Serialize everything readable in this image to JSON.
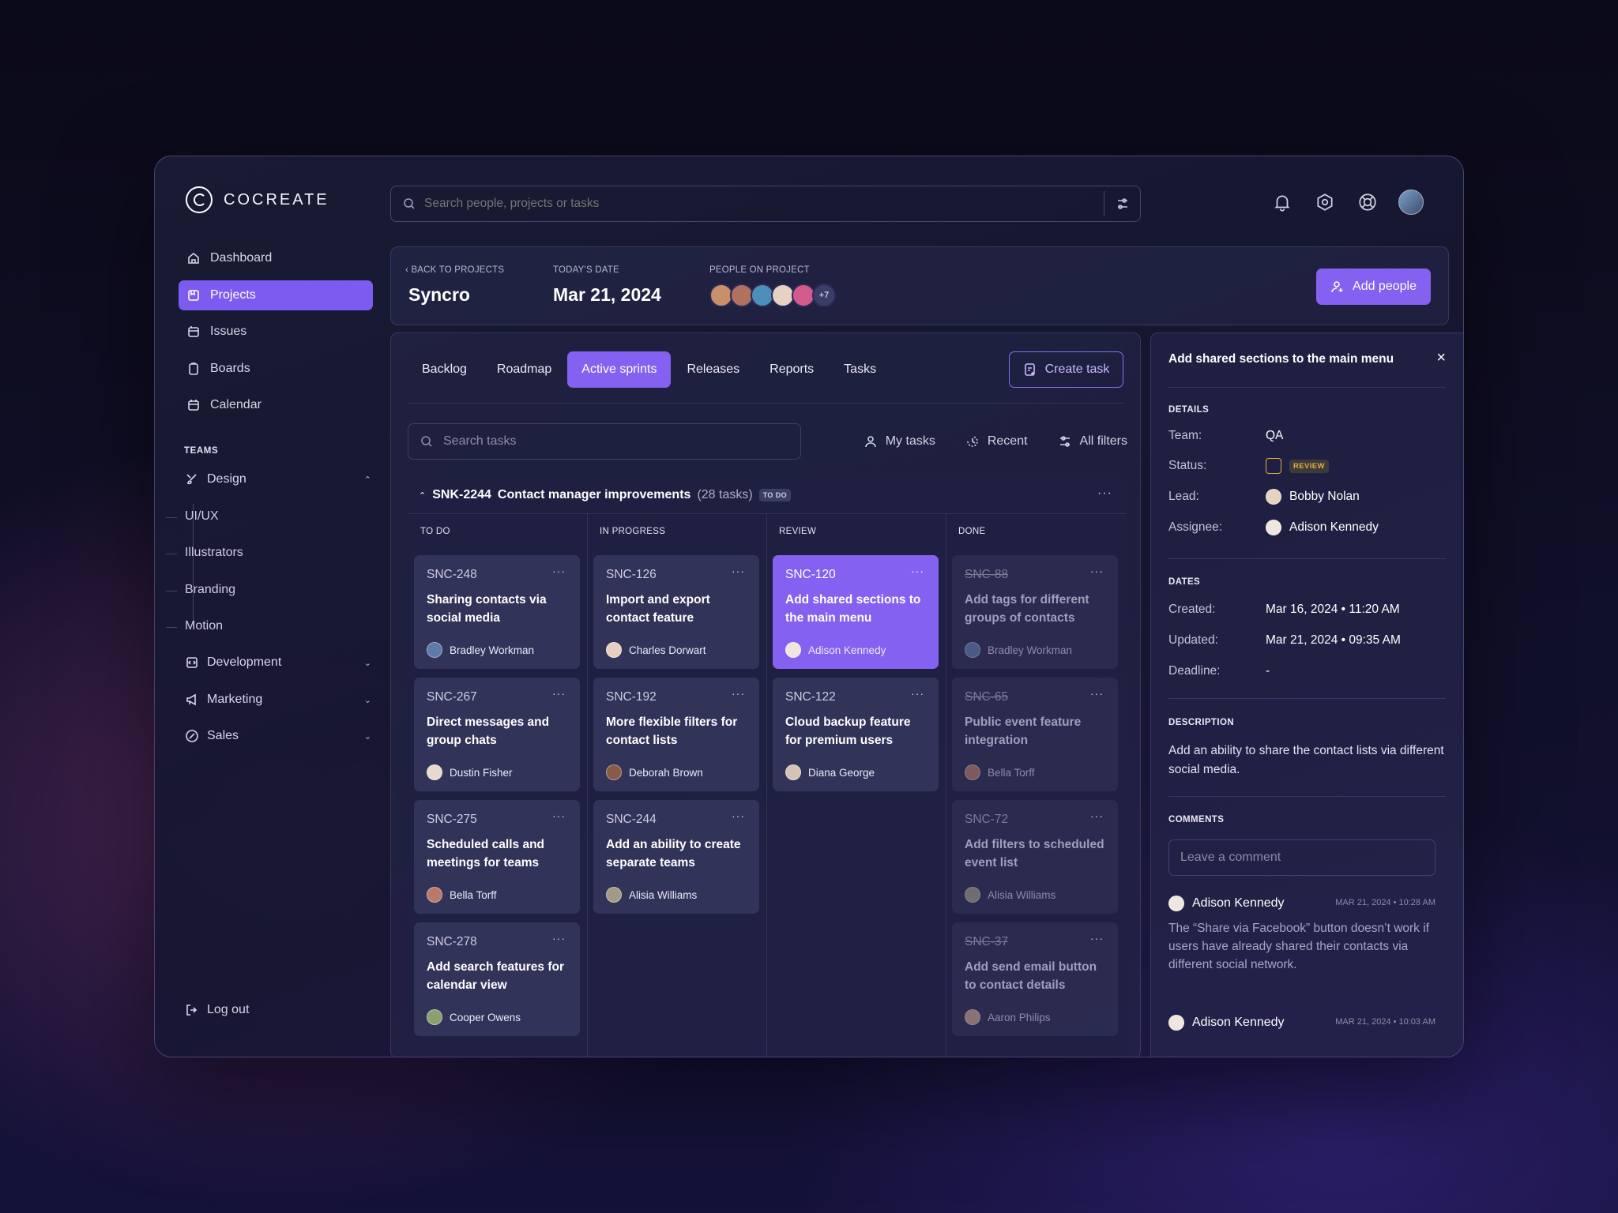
{
  "brand": {
    "name": "COCREATE"
  },
  "nav": [
    {
      "label": "Dashboard",
      "icon": "home-icon"
    },
    {
      "label": "Projects",
      "icon": "projects-icon"
    },
    {
      "label": "Issues",
      "icon": "issues-icon"
    },
    {
      "label": "Boards",
      "icon": "boards-icon"
    },
    {
      "label": "Calendar",
      "icon": "calendar-icon"
    }
  ],
  "teams": {
    "label": "TEAMS",
    "design": "Design",
    "sub": [
      "UI/UX",
      "Illustrators",
      "Branding",
      "Motion"
    ],
    "development": "Development",
    "marketing": "Marketing",
    "sales": "Sales"
  },
  "logout": "Log out",
  "search": {
    "placeholder": "Search people, projects or tasks"
  },
  "header": {
    "back": "BACK TO PROJECTS",
    "project": "Syncro",
    "date_label": "TODAY'S DATE",
    "date": "Mar 21, 2024",
    "people_label": "PEOPLE ON PROJECT",
    "people_more": "+7",
    "add_people": "Add people"
  },
  "tabs": [
    "Backlog",
    "Roadmap",
    "Active sprints",
    "Releases",
    "Reports",
    "Tasks"
  ],
  "create_task": "Create task",
  "task_search": {
    "placeholder": "Search tasks"
  },
  "filters": {
    "my": "My tasks",
    "recent": "Recent",
    "all": "All filters"
  },
  "group": {
    "id": "SNK-2244",
    "title": "Contact manager improvements",
    "count": "(28 tasks)",
    "status": "TO DO"
  },
  "columns": [
    "TO DO",
    "IN PROGRESS",
    "REVIEW",
    "DONE"
  ],
  "cards": {
    "todo": [
      {
        "id": "SNC-248",
        "title": "Sharing contacts via social media",
        "user": "Bradley Workman"
      },
      {
        "id": "SNC-267",
        "title": "Direct messages and group chats",
        "user": "Dustin Fisher"
      },
      {
        "id": "SNC-275",
        "title": "Scheduled calls and meetings for teams",
        "user": "Bella Torff"
      },
      {
        "id": "SNC-278",
        "title": "Add search features for calendar view",
        "user": "Cooper Owens"
      }
    ],
    "progress": [
      {
        "id": "SNC-126",
        "title": "Import and export contact feature",
        "user": "Charles Dorwart"
      },
      {
        "id": "SNC-192",
        "title": "More flexible filters for contact lists",
        "user": "Deborah Brown"
      },
      {
        "id": "SNC-244",
        "title": "Add an ability to create separate teams",
        "user": "Alisia Williams"
      }
    ],
    "review": [
      {
        "id": "SNC-120",
        "title": "Add shared sections to the main menu",
        "user": "Adison Kennedy"
      },
      {
        "id": "SNC-122",
        "title": "Cloud backup feature for premium users",
        "user": "Diana George"
      }
    ],
    "done": [
      {
        "id": "SNC-88",
        "title": "Add tags for different groups of contacts",
        "user": "Bradley Workman"
      },
      {
        "id": "SNC-65",
        "title": "Public event feature integration",
        "user": "Bella Torff"
      },
      {
        "id": "SNC-72",
        "title": "Add filters to scheduled event list",
        "user": "Alisia Williams"
      },
      {
        "id": "SNC-37",
        "title": "Add send email button to contact details",
        "user": "Aaron Philips"
      }
    ]
  },
  "panel": {
    "title": "Add shared sections to the main menu",
    "details": "DETAILS",
    "team_k": "Team:",
    "team_v": "QA",
    "status_k": "Status:",
    "status_v": "REVIEW",
    "lead_k": "Lead:",
    "lead_v": "Bobby Nolan",
    "assignee_k": "Assignee:",
    "assignee_v": "Adison Kennedy",
    "dates": "DATES",
    "created_k": "Created:",
    "created_v": "Mar 16, 2024 • 11:20 AM",
    "updated_k": "Updated:",
    "updated_v": "Mar 21, 2024 • 09:35 AM",
    "deadline_k": "Deadline:",
    "deadline_v": "-",
    "desc_label": "DESCRIPTION",
    "desc": "Add an ability to share the contact lists via different social media.",
    "comments": "COMMENTS",
    "comment_placeholder": "Leave a comment",
    "c1_who": "Adison Kennedy",
    "c1_when": "MAR 21, 2024 • 10:28 AM",
    "c1_text": "The “Share via Facebook” button doesn’t work if users have already shared their contacts via different social network.",
    "c2_who": "Adison Kennedy",
    "c2_when": "MAR 21, 2024 • 10:03 AM"
  },
  "colors": {
    "accent": "#8461f0",
    "review": "#e5ad3f"
  }
}
